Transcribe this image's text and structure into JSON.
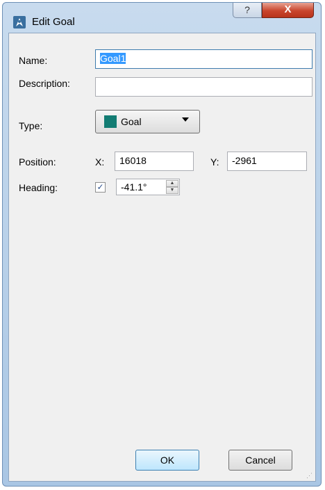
{
  "window": {
    "title": "Edit Goal",
    "help_glyph": "?",
    "close_glyph": "X",
    "icon": "marker-icon"
  },
  "form": {
    "name_label": "Name:",
    "name_value": "Goal1",
    "description_label": "Description:",
    "description_value": "",
    "type_label": "Type:",
    "type_value": "Goal",
    "type_color": "#127c73",
    "position_label": "Position:",
    "x_label": "X:",
    "x_value": "16018",
    "y_label": "Y:",
    "y_value": "-2961",
    "heading_label": "Heading:",
    "heading_checked": true,
    "heading_value": "-41.1°"
  },
  "buttons": {
    "ok": "OK",
    "cancel": "Cancel"
  }
}
